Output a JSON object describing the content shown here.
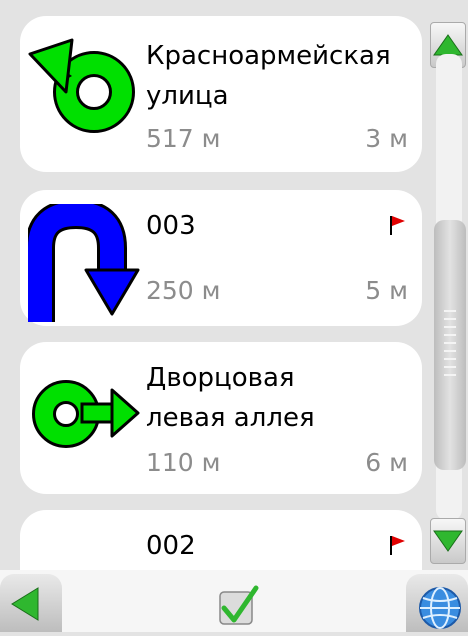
{
  "route": {
    "items": [
      {
        "name_lines": [
          "Красноармейская",
          "улица"
        ],
        "distance": "517 м",
        "time": "3 м",
        "maneuver": "roundabout-left-icon",
        "waypoint": false
      },
      {
        "name_lines": [
          "003"
        ],
        "distance": "250 м",
        "time": "5 м",
        "maneuver": "u-turn-icon",
        "waypoint": true
      },
      {
        "name_lines": [
          "Дворцовая",
          "левая аллея"
        ],
        "distance": "110 м",
        "time": "6 м",
        "maneuver": "roundabout-right-icon",
        "waypoint": false
      },
      {
        "name_lines": [
          "002"
        ],
        "distance": "",
        "time": "",
        "maneuver": "",
        "waypoint": true
      }
    ]
  },
  "toolbar": {
    "back": "back-arrow-icon",
    "confirm": "checkmark-icon",
    "map": "globe-icon"
  },
  "colors": {
    "turn_green": "#00e000",
    "uturn_blue": "#0000ff",
    "flag_red": "#e00000",
    "accent_green": "#2fb72f"
  }
}
